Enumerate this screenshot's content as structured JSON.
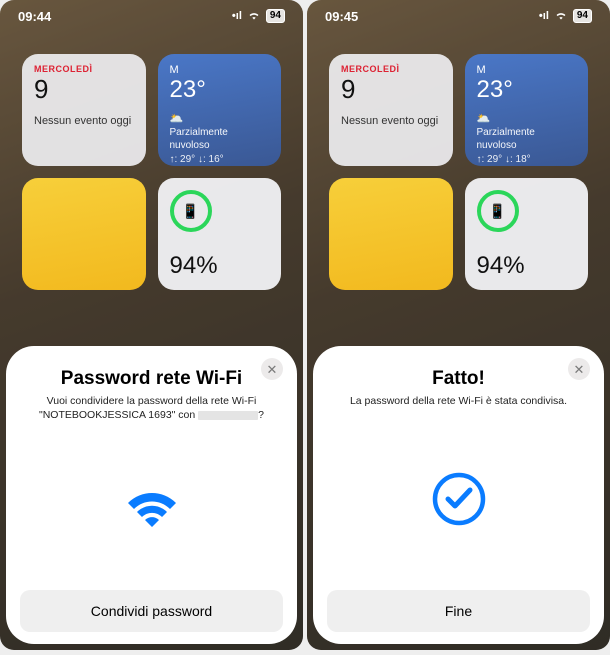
{
  "screens": [
    {
      "status": {
        "time": "09:44",
        "battery": "94"
      },
      "widgets": {
        "calendar": {
          "weekday": "MERCOLEDÌ",
          "date": "9",
          "event": "Nessun evento oggi"
        },
        "weather": {
          "loc": "M",
          "temp": "23°",
          "cond": "Parzialmente nuvoloso",
          "hilo": "↑: 29° ↓: 16°"
        },
        "battery_widget": {
          "pct": "94%",
          "icon": "📱"
        }
      },
      "sheet": {
        "title": "Password rete Wi-Fi",
        "line1": "Vuoi condividere la password della rete Wi-Fi",
        "network": "\"NOTEBOOKJESSICA 1693\" con",
        "tail": "?",
        "button": "Condividi password",
        "icon": "wifi"
      }
    },
    {
      "status": {
        "time": "09:45",
        "battery": "94"
      },
      "widgets": {
        "calendar": {
          "weekday": "MERCOLEDÌ",
          "date": "9",
          "event": "Nessun evento oggi"
        },
        "weather": {
          "loc": "M",
          "temp": "23°",
          "cond": "Parzialmente nuvoloso",
          "hilo": "↑: 29° ↓: 18°"
        },
        "battery_widget": {
          "pct": "94%",
          "icon": "📱"
        }
      },
      "sheet": {
        "title": "Fatto!",
        "line1": "La password della rete Wi-Fi è stata condivisa.",
        "button": "Fine",
        "icon": "check"
      }
    }
  ]
}
